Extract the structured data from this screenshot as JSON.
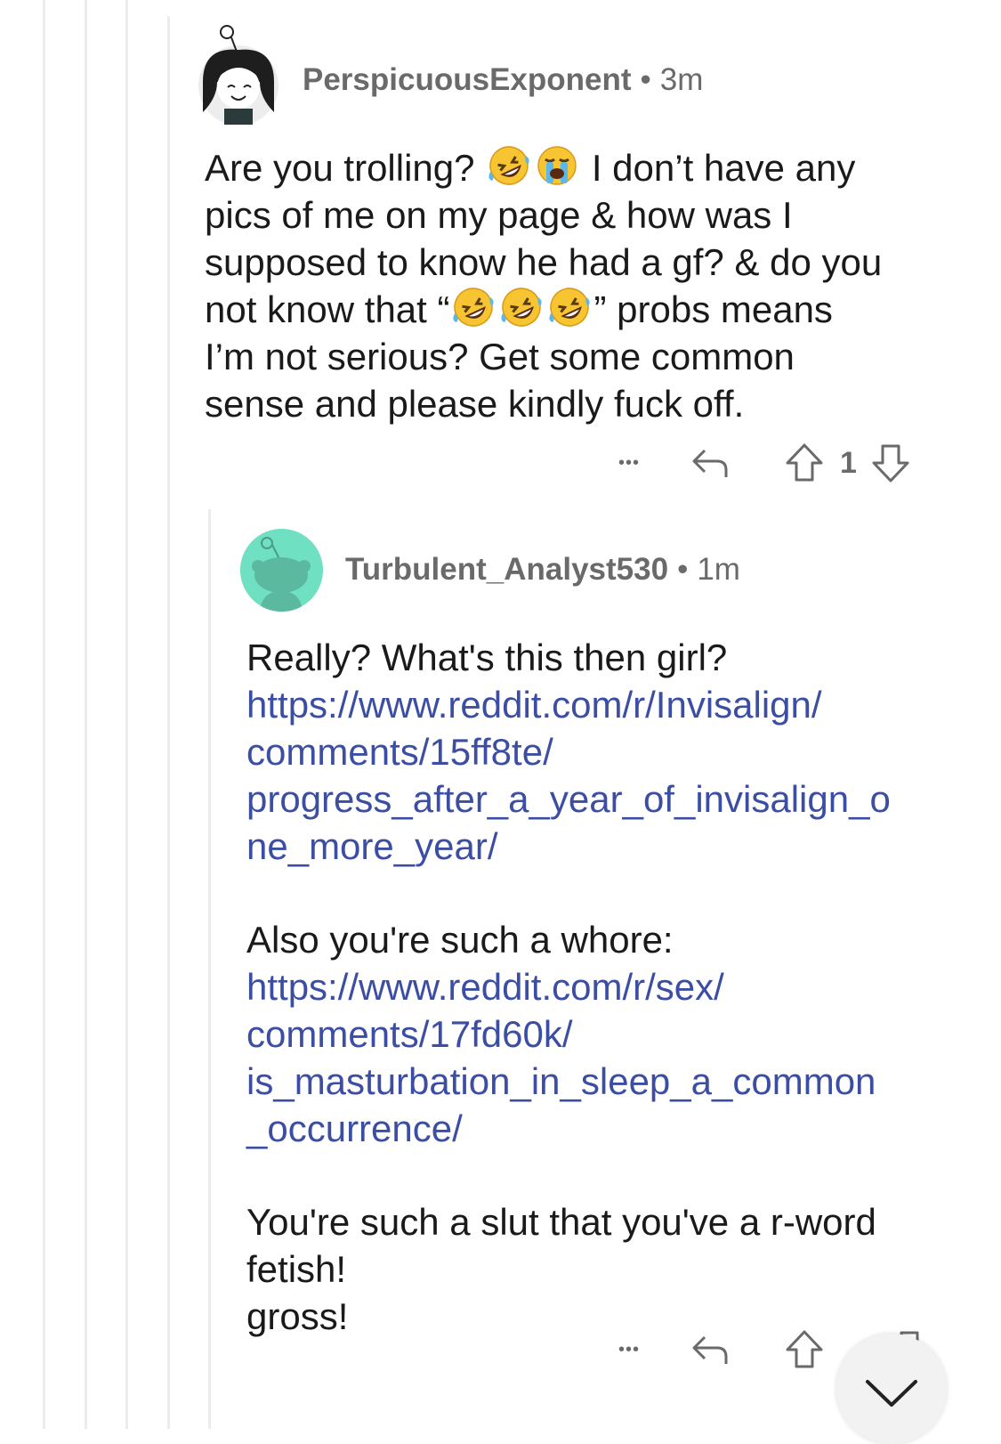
{
  "colors": {
    "thread_line": "#ececec",
    "meta_text": "#6a6a6a",
    "body_text": "#1a1a1b",
    "link": "#3b4ea3",
    "avatar2_bg": "#6fe0c2"
  },
  "comment1": {
    "username": "PerspicuousExponent",
    "separator": "•",
    "age": "3m",
    "avatar_icon": "snoo-avatar-girl-icon",
    "body": {
      "l1_a": "Are you trolling?",
      "l1_emoji": [
        "rolling-on-floor-laughing-emoji",
        "loudly-crying-emoji"
      ],
      "l1_b": "I don’t have any",
      "l2": "pics of me on my page & how was I",
      "l3": "supposed to know he had a gf? & do you",
      "l4_a": "not know that “",
      "l4_emoji": [
        "rolling-on-floor-laughing-emoji",
        "rolling-on-floor-laughing-emoji",
        "rolling-on-floor-laughing-emoji"
      ],
      "l4_b": "” probs means",
      "l5": "I’m not serious? Get some common",
      "l6": "sense and please kindly fuck off."
    },
    "actions": {
      "more": "•••",
      "reply_icon": "reply-icon",
      "upvote_icon": "upvote-icon",
      "score": "1",
      "downvote_icon": "downvote-icon"
    }
  },
  "comment2": {
    "username": "Turbulent_Analyst530",
    "separator": "•",
    "age": "1m",
    "avatar_icon": "snoo-avatar-default-icon",
    "body": {
      "p1": "Really? What's this then girl?",
      "link1_lines": [
        "https://www.reddit.com/r/Invisalign/",
        "comments/15ff8te/",
        "progress_after_a_year_of_invisalign_o",
        "ne_more_year/"
      ],
      "p2": "Also you're such a whore:",
      "link2_lines": [
        "https://www.reddit.com/r/sex/",
        "comments/17fd60k/",
        "is_masturbation_in_sleep_a_common",
        "_occurrence/"
      ],
      "p3_l1": "You're such a slut that you've a r-word",
      "p3_l2": "fetish!",
      "p3_l3": "gross!"
    },
    "actions": {
      "more": "•••",
      "reply_icon": "reply-icon",
      "upvote_icon": "upvote-icon",
      "downvote_icon": "downvote-icon"
    }
  },
  "scroll_button": {
    "icon": "chevron-down-icon"
  }
}
